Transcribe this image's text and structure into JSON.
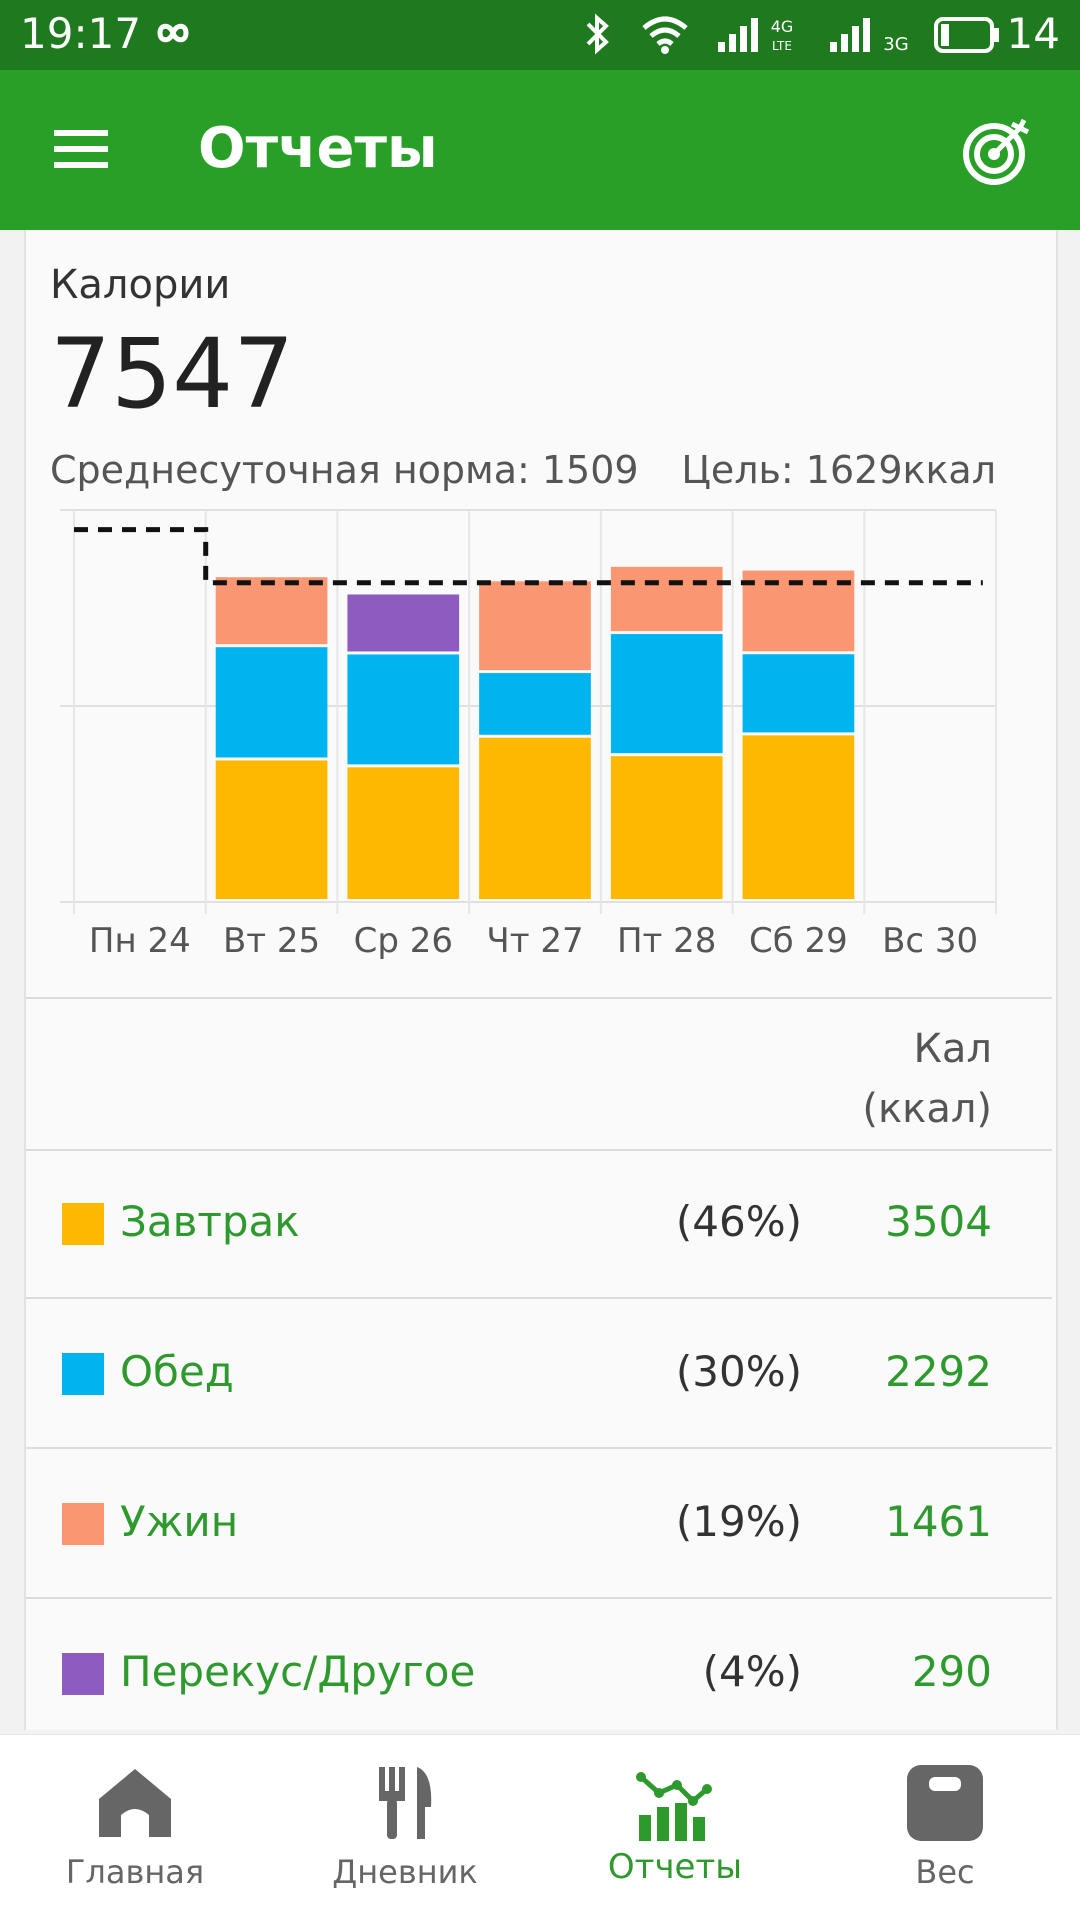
{
  "status_bar": {
    "time": "19:17",
    "battery": "14"
  },
  "app_bar": {
    "title": "Отчеты",
    "menu_icon": "hamburger-menu-icon",
    "action_icon": "target-icon"
  },
  "summary": {
    "label": "Калории",
    "total": "7547",
    "avg_text": "Среднесуточная норма: 1509",
    "goal_text": "Цель: 1629ккал"
  },
  "colors": {
    "breakfast": "#ffb800",
    "lunch": "#00b4f0",
    "dinner": "#fa9672",
    "snack": "#8e5cc0",
    "accent": "#28a028"
  },
  "chart_data": {
    "type": "bar",
    "stacked": true,
    "categories": [
      "Пн 24",
      "Вт 25",
      "Ср 26",
      "Чт 27",
      "Пт 28",
      "Сб 29",
      "Вс 30"
    ],
    "series": [
      {
        "name": "Завтрак",
        "values": [
          0,
          722,
          687,
          838,
          744,
          850
        ]
      },
      {
        "name": "Обед",
        "values": [
          0,
          578,
          576,
          330,
          623,
          414
        ]
      },
      {
        "name": "Ужин",
        "values": [
          0,
          357,
          0,
          468,
          343,
          427
        ]
      },
      {
        "name": "Перекус/Другое",
        "values": [
          0,
          0,
          306,
          0,
          0,
          0
        ]
      }
    ],
    "goal_line": [
      1900,
      1629,
      1629,
      1629,
      1629,
      1629,
      1629
    ],
    "ylim": [
      0,
      2000
    ],
    "grid": true,
    "legend": "none"
  },
  "table": {
    "header": "Кал (ккал)",
    "rows": [
      {
        "name": "Завтрак",
        "pct": "(46%)",
        "value": "3504",
        "color_key": "breakfast"
      },
      {
        "name": "Обед",
        "pct": "(30%)",
        "value": "2292",
        "color_key": "lunch"
      },
      {
        "name": "Ужин",
        "pct": "(19%)",
        "value": "1461",
        "color_key": "dinner"
      },
      {
        "name": "Перекус/Другое",
        "pct": "(4%)",
        "value": "290",
        "color_key": "snack"
      }
    ]
  },
  "bottom_nav": [
    {
      "label": "Главная",
      "icon": "home-icon",
      "active": false
    },
    {
      "label": "Дневник",
      "icon": "fork-knife-icon",
      "active": false
    },
    {
      "label": "Отчеты",
      "icon": "chart-icon",
      "active": true
    },
    {
      "label": "Вес",
      "icon": "scale-icon",
      "active": false
    }
  ]
}
